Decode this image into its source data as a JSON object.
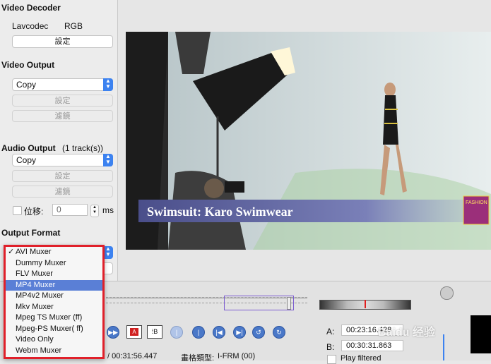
{
  "video_decoder": {
    "heading": "Video Decoder",
    "codec": "Lavcodec",
    "colorspace": "RGB",
    "config_label": "設定"
  },
  "video_output": {
    "heading": "Video Output",
    "codec_value": "Copy",
    "config_label": "設定",
    "filter_label": "濾鏡"
  },
  "audio_output": {
    "heading": "Audio Output",
    "tracks": "(1 track(s))",
    "codec_value": "Copy",
    "config_label": "設定",
    "filter_label": "濾鏡",
    "shift_label": "位移:",
    "shift_value": "0",
    "shift_unit": "ms"
  },
  "output_format": {
    "heading": "Output Format",
    "dropdown_items": [
      {
        "label": "AVI Muxer",
        "checked": true,
        "highlighted": false
      },
      {
        "label": "Dummy Muxer",
        "checked": false,
        "highlighted": false
      },
      {
        "label": "FLV Muxer",
        "checked": false,
        "highlighted": false
      },
      {
        "label": "MP4 Muxer",
        "checked": false,
        "highlighted": true
      },
      {
        "label": "MP4v2 Muxer",
        "checked": false,
        "highlighted": false
      },
      {
        "label": "Mkv Muxer",
        "checked": false,
        "highlighted": false
      },
      {
        "label": "Mpeg TS Muxer (ff)",
        "checked": false,
        "highlighted": false
      },
      {
        "label": "Mpeg-PS Muxer( ff)",
        "checked": false,
        "highlighted": false
      },
      {
        "label": "Video Only",
        "checked": false,
        "highlighted": false
      },
      {
        "label": "Webm Muxer",
        "checked": false,
        "highlighted": false
      }
    ]
  },
  "video": {
    "caption": "Swimsuit: Karo Swimwear",
    "badge_text": "FASHION"
  },
  "selection": {
    "a_label": "A:",
    "a_time": "00:23:16.428",
    "b_label": "B:",
    "b_time": "00:30:31.863",
    "play_filtered_label": "Play filtered"
  },
  "status": {
    "duration": "/ 00:31:56.447",
    "frame_type_label": "畫格類型:",
    "frame_type_value": "I-FRM (00)"
  },
  "watermark": "Baidu 经验",
  "colors": {
    "menu_border": "#e0202a",
    "highlight": "#5a7fd6",
    "accent_blue": "#3c82f0"
  }
}
